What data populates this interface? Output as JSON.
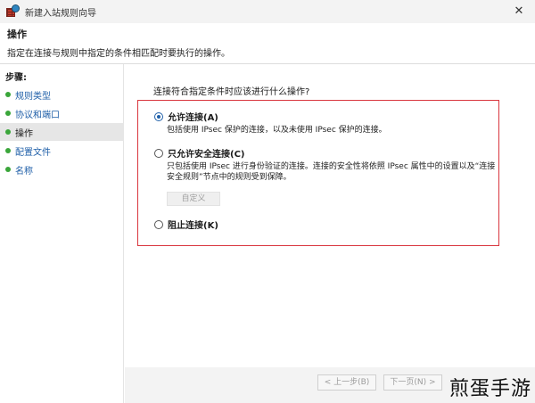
{
  "window": {
    "title": "新建入站规则向导",
    "icon": "firewall-icon",
    "close_glyph": "✕"
  },
  "header": {
    "title": "操作",
    "description": "指定在连接与规则中指定的条件相匹配时要执行的操作。"
  },
  "sidebar": {
    "steps_label": "步骤:",
    "items": [
      {
        "label": "规则类型",
        "active": false
      },
      {
        "label": "协议和端口",
        "active": false
      },
      {
        "label": "操作",
        "active": true
      },
      {
        "label": "配置文件",
        "active": false
      },
      {
        "label": "名称",
        "active": false
      }
    ],
    "dot_color": "#3aa63a"
  },
  "main": {
    "question": "连接符合指定条件时应该进行什么操作?",
    "highlight_color": "#d9363e",
    "options": [
      {
        "label": "允许连接(A)",
        "description": "包括使用 IPsec 保护的连接，以及未使用 IPsec 保护的连接。",
        "checked": true
      },
      {
        "label": "只允许安全连接(C)",
        "description": "只包括使用 IPsec 进行身份验证的连接。连接的安全性将依照 IPsec 属性中的设置以及“连接安全规则”节点中的规则受到保障。",
        "checked": false
      },
      {
        "label": "阻止连接(K)",
        "description": "",
        "checked": false
      }
    ],
    "customize_button": "自定义"
  },
  "footer": {
    "back_button": "< 上一步(B)",
    "next_button": "下一页(N) >"
  },
  "watermark": "煎蛋手游"
}
